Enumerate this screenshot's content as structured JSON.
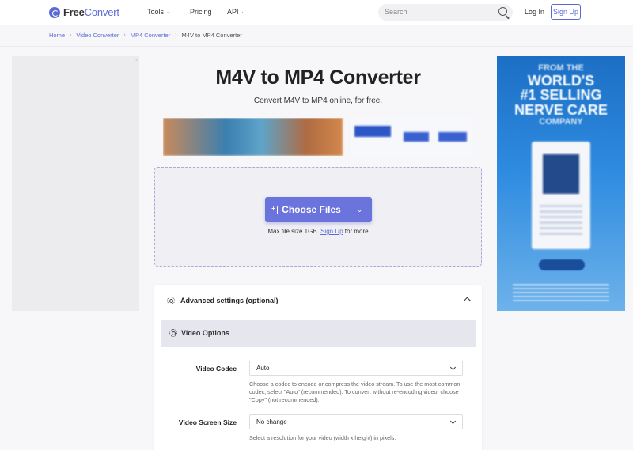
{
  "header": {
    "brand_free": "Free",
    "brand_convert": "Convert",
    "nav": [
      {
        "label": "Tools",
        "has_dropdown": true
      },
      {
        "label": "Pricing",
        "has_dropdown": false
      },
      {
        "label": "API",
        "has_dropdown": true
      }
    ],
    "search_placeholder": "Search",
    "login": "Log In",
    "signup": "Sign Up"
  },
  "breadcrumb": [
    "Home",
    "Video Converter",
    "MP4 Converter",
    "M4V to MP4 Converter"
  ],
  "main": {
    "title": "M4V to MP4 Converter",
    "subtitle": "Convert M4V to MP4 online, for free.",
    "choose_files": "Choose Files",
    "max_size_prefix": "Max file size 1GB.",
    "max_size_link": "Sign Up",
    "max_size_suffix": "for more"
  },
  "advanced": {
    "title": "Advanced settings (optional)",
    "section": "Video Options",
    "codec": {
      "label": "Video Codec",
      "value": "Auto",
      "help": "Choose a codec to encode or compress the video stream. To use the most common codec, select \"Auto\" (recommended). To convert without re-encoding video, choose \"Copy\" (not recommended)."
    },
    "screen_size": {
      "label": "Video Screen Size",
      "value": "No change",
      "help": "Select a resolution for your video (width x height) in pixels."
    }
  },
  "ads": {
    "right_line1": "FROM THE",
    "right_line2": "WORLD'S",
    "right_line3": "#1 SELLING",
    "right_line4": "NERVE CARE",
    "right_line5": "COMPANY"
  },
  "colors": {
    "accent": "#5b6bd5",
    "button": "#6b73dc",
    "ad_blue": "#2e8be0"
  }
}
